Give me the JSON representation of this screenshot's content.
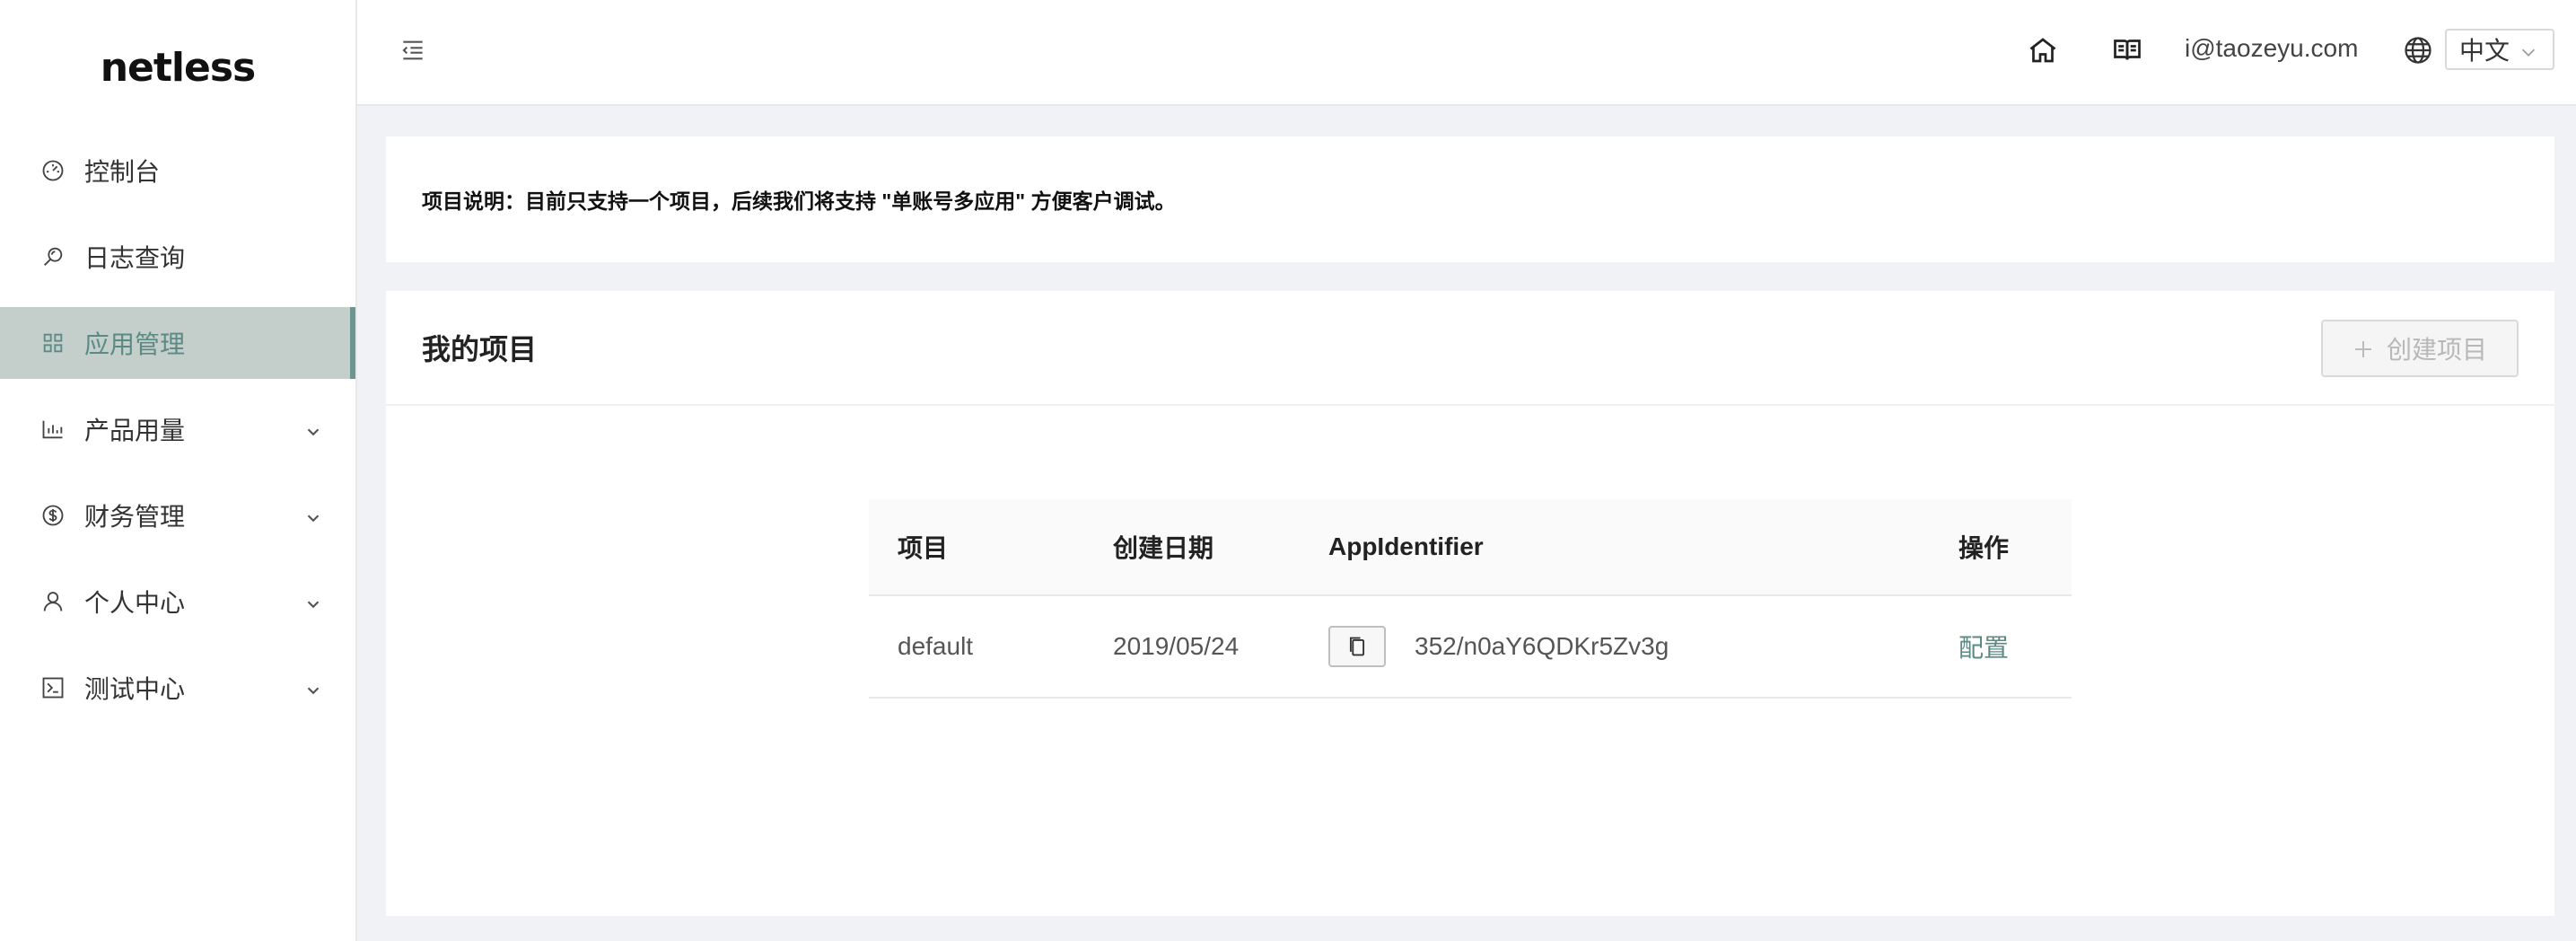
{
  "brand": {
    "logo_text": "netless"
  },
  "sidebar": {
    "items": [
      {
        "label": "控制台",
        "icon": "dashboard-icon",
        "expandable": false,
        "active": false
      },
      {
        "label": "日志查询",
        "icon": "search-log-icon",
        "expandable": false,
        "active": false
      },
      {
        "label": "应用管理",
        "icon": "grid-icon",
        "expandable": false,
        "active": true
      },
      {
        "label": "产品用量",
        "icon": "bar-chart-icon",
        "expandable": true,
        "active": false
      },
      {
        "label": "财务管理",
        "icon": "dollar-icon",
        "expandable": true,
        "active": false
      },
      {
        "label": "个人中心",
        "icon": "user-icon",
        "expandable": true,
        "active": false
      },
      {
        "label": "测试中心",
        "icon": "terminal-icon",
        "expandable": true,
        "active": false
      }
    ]
  },
  "header": {
    "user_email": "i@taozeyu.com",
    "language": "中文"
  },
  "notice": {
    "text": "项目说明：目前只支持一个项目，后续我们将支持 \"单账号多应用\" 方便客户调试。"
  },
  "projects": {
    "title": "我的项目",
    "create_label": "创建项目",
    "columns": [
      "项目",
      "创建日期",
      "AppIdentifier",
      "操作"
    ],
    "rows": [
      {
        "name": "default",
        "created": "2019/05/24",
        "app_identifier": "352/n0aY6QDKr5Zv3g",
        "action": "配置"
      }
    ]
  },
  "colors": {
    "accent": "#5b8a84",
    "active_bg": "#c4cfcb",
    "page_bg": "#f0f2f5"
  }
}
